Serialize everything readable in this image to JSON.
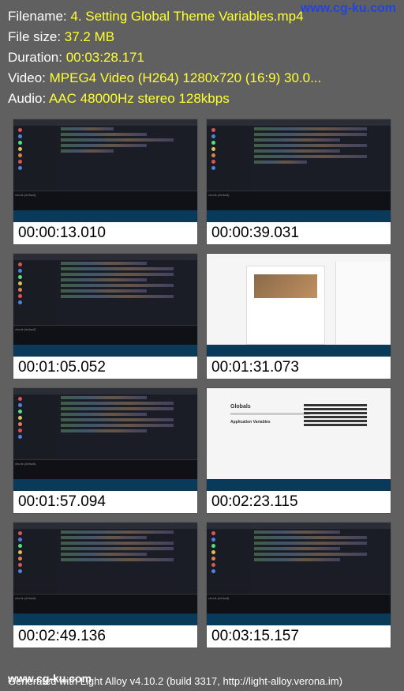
{
  "watermark_top": "www.cg-ku.com",
  "watermark_bottom": "www.cg-ku.com",
  "header": {
    "filename_label": "Filename: ",
    "filename_value": "4. Setting Global Theme Variables.mp4",
    "filesize_label": "File size: ",
    "filesize_value": "37.2 MB",
    "duration_label": "Duration: ",
    "duration_value": "00:03:28.171",
    "video_label": "Video: ",
    "video_value": "MPEG4 Video (H264) 1280x720 (16:9) 30.0...",
    "audio_label": "Audio: ",
    "audio_value": "AAC 48000Hz stereo 128kbps"
  },
  "thumbnails": [
    {
      "time": "00:00:13.010",
      "type": "code"
    },
    {
      "time": "00:00:39.031",
      "type": "code"
    },
    {
      "time": "00:01:05.052",
      "type": "code"
    },
    {
      "time": "00:01:31.073",
      "type": "browser"
    },
    {
      "time": "00:01:57.094",
      "type": "code"
    },
    {
      "time": "00:02:23.115",
      "type": "doc"
    },
    {
      "time": "00:02:49.136",
      "type": "code"
    },
    {
      "time": "00:03:15.157",
      "type": "code"
    }
  ],
  "footer": "Generated with Light Alloy v4.10.2 (build 3317, http://light-alloy.verona.im)"
}
